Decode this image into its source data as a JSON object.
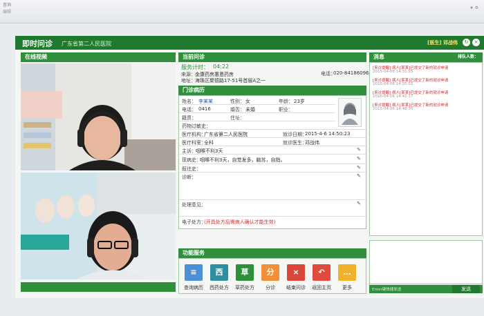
{
  "browser": {
    "tab_title": "咨询",
    "menu_hint": "编辑",
    "right_tools": "★ ⚙"
  },
  "header": {
    "app_title": "即时问诊",
    "hospital": "广东省第二人民医院",
    "doctor_label": "[医生]",
    "doctor_name": "邓战伟",
    "icon_refresh": "↻",
    "icon_close": "×"
  },
  "video": {
    "title": "在线视频"
  },
  "consult": {
    "title": "当前问诊",
    "timer_label": "服务计时：",
    "timer_value": "04:22",
    "source_label": "来源：",
    "source_value": "金康药房惠恩药房",
    "phone_label": "电话：",
    "phone_value": "020-84186096",
    "address_label": "地址：",
    "address_value": "海珠区聚德路17-51号首层A之一"
  },
  "record": {
    "title": "门诊病历",
    "name_label": "姓名：",
    "name_value": "李某某",
    "gender_label": "性别：",
    "gender_value": "女",
    "age_label": "年龄：",
    "age_value": "23岁",
    "tel_label": "电话：",
    "tel_value": "0416",
    "marriage_label": "婚否：",
    "marriage_value": "未婚",
    "job_label": "职业：",
    "origin_label": "籍贯：",
    "addr_label": "住址：",
    "allergy_label": "药物过敏史：",
    "org_label": "医疗机构：",
    "org_value": "广东省第二人民医院",
    "date_label": "就诊日期：",
    "date_value": "2015-4-6 14:50:23",
    "dept_label": "医疗科室：",
    "dept_value": "全科",
    "doc_label": "就诊医生：",
    "doc_value": "邓战伟",
    "complaint_label": "主诉：",
    "complaint_value": "咽喉不利3天",
    "history_label": "现病史：",
    "history_value": "咽喉不利3天，自觉发多，脑苏，自指。",
    "past_label": "既往史：",
    "diagnosis_label": "诊断：",
    "advice_label": "处理意见：",
    "rx_label": "电子处方：",
    "rx_value": "(开具处方后需病人确认才能生效)"
  },
  "functions": {
    "title": "功能服务",
    "buttons": [
      {
        "glyph": "≡",
        "label": "查询病历",
        "color": "#4d8fd6"
      },
      {
        "glyph": "西",
        "label": "西药处方",
        "color": "#2e8fa0"
      },
      {
        "glyph": "草",
        "label": "草药处方",
        "color": "#2f8f3c"
      },
      {
        "glyph": "分",
        "label": "分诊",
        "color": "#f0913a"
      },
      {
        "glyph": "×",
        "label": "结束问诊",
        "color": "#d9463a"
      },
      {
        "glyph": "↶",
        "label": "返回主页",
        "color": "#e04b3e"
      },
      {
        "glyph": "…",
        "label": "更多",
        "color": "#f0b12c"
      }
    ]
  },
  "messages": {
    "title": "消息",
    "queue": "排队人数：",
    "items": [
      {
        "text": "[来诊提醒] 病人[某某]已提交了新的就诊申请",
        "time": "2015-04-06 14:31:55"
      },
      {
        "text": "[来诊提醒] 病人[某某]已提交了新的就诊申请",
        "time": "2015-04-06 14:35:02"
      },
      {
        "text": "[来诊提醒] 病人[某某]已提交了新的就诊申请",
        "time": "2015-04-06 14:42:17"
      },
      {
        "text": "[来诊提醒] 病人[某某]已提交了新的就诊申请",
        "time": "2015-04-06 14:48:30"
      }
    ],
    "input_hint": "Enter键快捷发送",
    "send": "发送"
  }
}
